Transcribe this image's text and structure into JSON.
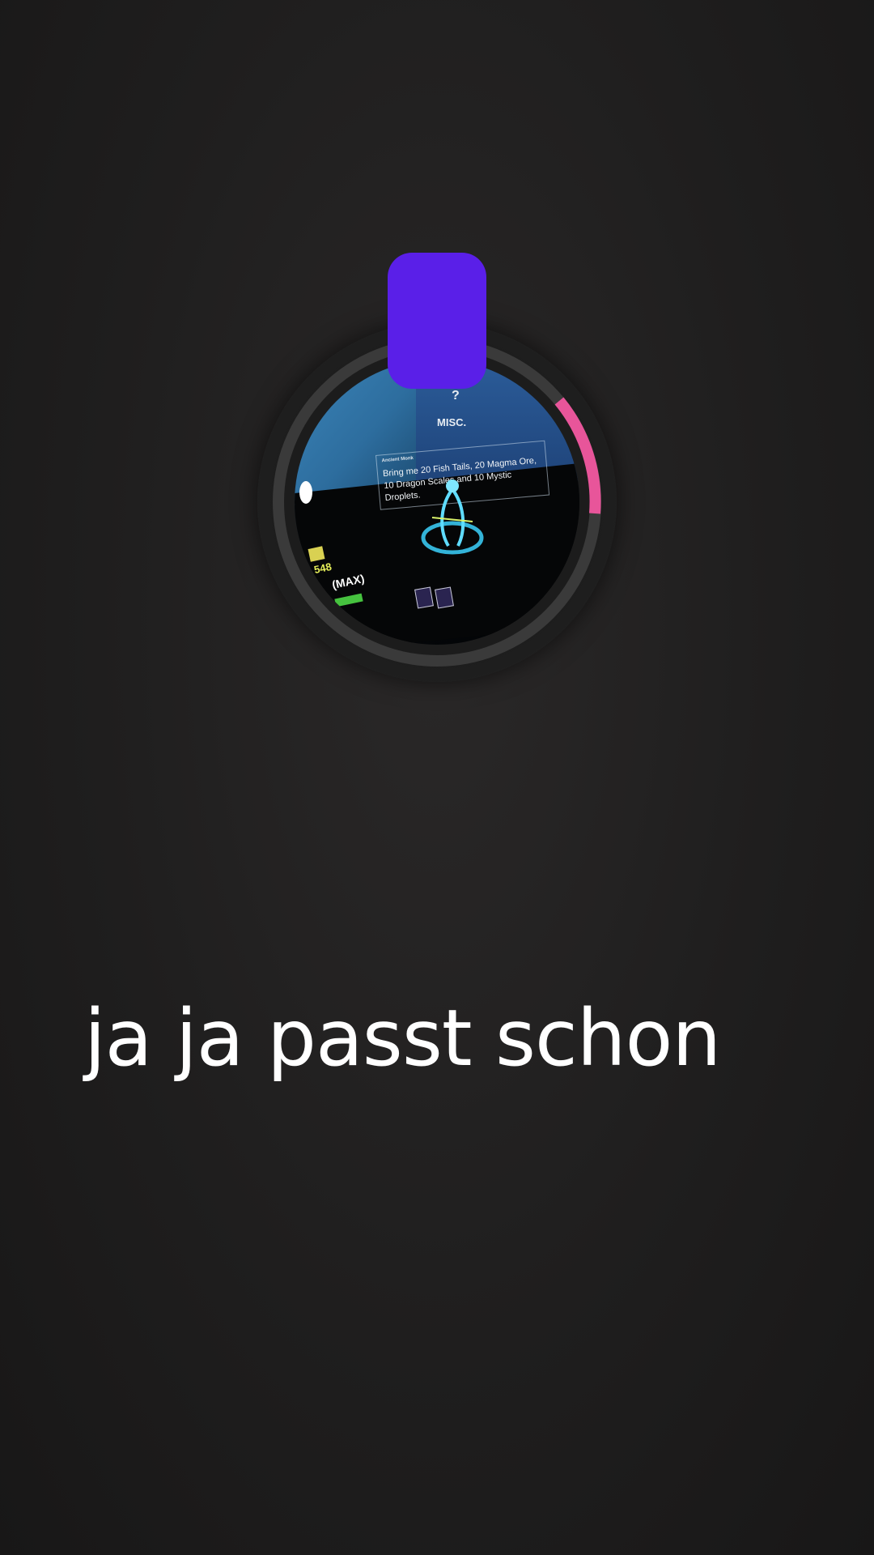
{
  "camera": {
    "progress_ring_color": "#e8559a",
    "ring_track_color": "#3a3a3a",
    "record_button_color": "#5a1fe8",
    "preview": {
      "misc_label": "MISC.",
      "question_mark": "?",
      "quest_title": "Ancient Monk",
      "quest_text": "Bring me 20 Fish Tails, 20 Magma Ore, 10 Dragon Scales and 10 Mystic Droplets.",
      "hud_level": "548",
      "hud_max": "(MAX)"
    }
  },
  "caption": {
    "text": "ja ja passt schon"
  }
}
